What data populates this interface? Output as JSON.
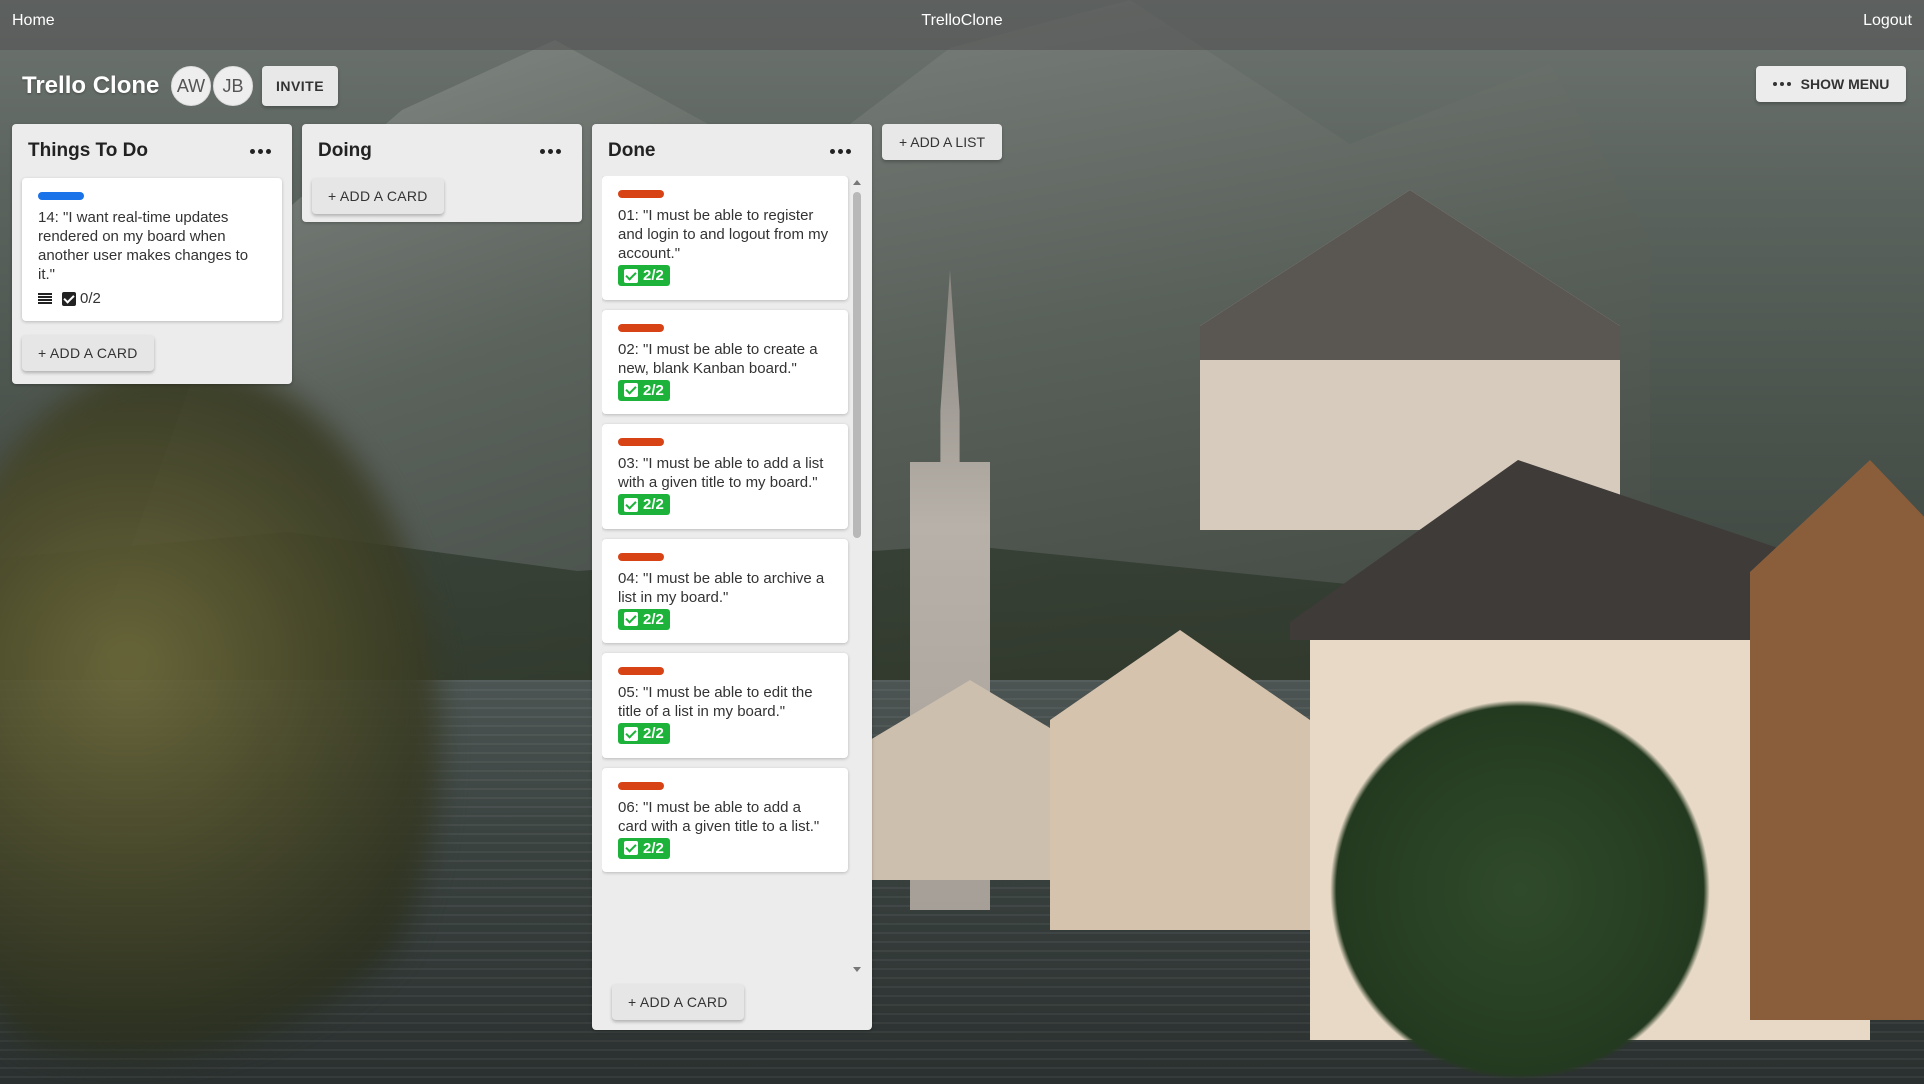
{
  "navbar": {
    "home": "Home",
    "brand": "TrelloClone",
    "logout": "Logout"
  },
  "board": {
    "title": "Trello Clone",
    "members": [
      "AW",
      "JB"
    ],
    "invite_label": "INVITE",
    "show_menu_label": "SHOW MENU",
    "add_list_label": "+ ADD A LIST"
  },
  "colors": {
    "label_blue": "#1a73e8",
    "label_red": "#d84315",
    "checklist_done": "#1db33a"
  },
  "lists": [
    {
      "title": "Things To Do",
      "add_card_label": "+ ADD A CARD",
      "cards": [
        {
          "label_color": "#1a73e8",
          "text": "14: \"I want real-time updates rendered on my board when another user makes changes to it.\"",
          "has_description": true,
          "checklist": "0/2"
        }
      ]
    },
    {
      "title": "Doing",
      "add_card_label": "+ ADD A CARD",
      "cards": []
    },
    {
      "title": "Done",
      "add_card_label": "+ ADD A CARD",
      "cards": [
        {
          "label_color": "#d84315",
          "text": "01: \"I must be able to register and login to and logout from my account.\"",
          "checklist": "2/2"
        },
        {
          "label_color": "#d84315",
          "text": "02: \"I must be able to create a new, blank Kanban board.\"",
          "checklist": "2/2"
        },
        {
          "label_color": "#d84315",
          "text": "03: \"I must be able to add a list with a given title to my board.\"",
          "checklist": "2/2"
        },
        {
          "label_color": "#d84315",
          "text": "04: \"I must be able to archive a list in my board.\"",
          "checklist": "2/2"
        },
        {
          "label_color": "#d84315",
          "text": "05: \"I must be able to edit the title of a list in my board.\"",
          "checklist": "2/2"
        },
        {
          "label_color": "#d84315",
          "text": "06: \"I must be able to add a card with a given title to a list.\"",
          "checklist": "2/2"
        }
      ]
    }
  ]
}
